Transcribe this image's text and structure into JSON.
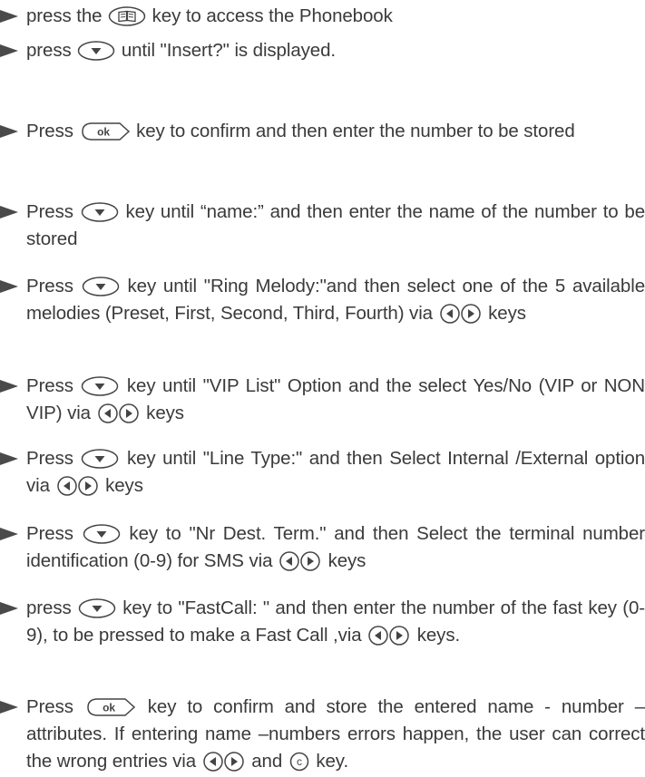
{
  "steps": [
    {
      "a": "press the ",
      "b": " key to access the Phonebook"
    },
    {
      "a": "press ",
      "b": " until  \"Insert?\" is displayed."
    },
    {
      "a": "Press ",
      "b": " key to confirm and then enter the number to be stored"
    },
    {
      "a": "Press ",
      "b": " key until “name:” and then enter the name  of the number to be stored"
    },
    {
      "a": "Press ",
      "b": " key until \"Ring Melody:\"and then select one of the 5 available  melodies (Preset, First, Second, Third, Fourth) via ",
      "c": " keys"
    },
    {
      "a": "Press ",
      "b": " key until  \"VIP List\" Option and the select Yes/No (VIP or NON VIP) via ",
      "c": " keys"
    },
    {
      "a": "Press ",
      "b": " key until  \"Line Type:\" and then Select Internal /External option via  ",
      "c": " keys"
    },
    {
      "a": "Press ",
      "b": " key to \"Nr Dest. Term.\" and then Select the terminal number identification  (0-9) for SMS via ",
      "c": "  keys"
    },
    {
      "a": "press ",
      "b": " key to \"FastCall: \" and then enter  the number of the fast key (0-9), to be pressed to make a Fast Call ,via ",
      "c": " keys."
    },
    {
      "a": "Press ",
      "b": " key to confirm and store the entered name - number – attributes. If entering name –numbers errors happen, the user can correct the wrong entries via ",
      "c": " and ",
      "d": " key."
    }
  ],
  "keys": {
    "ok": "ok",
    "c": "c"
  }
}
